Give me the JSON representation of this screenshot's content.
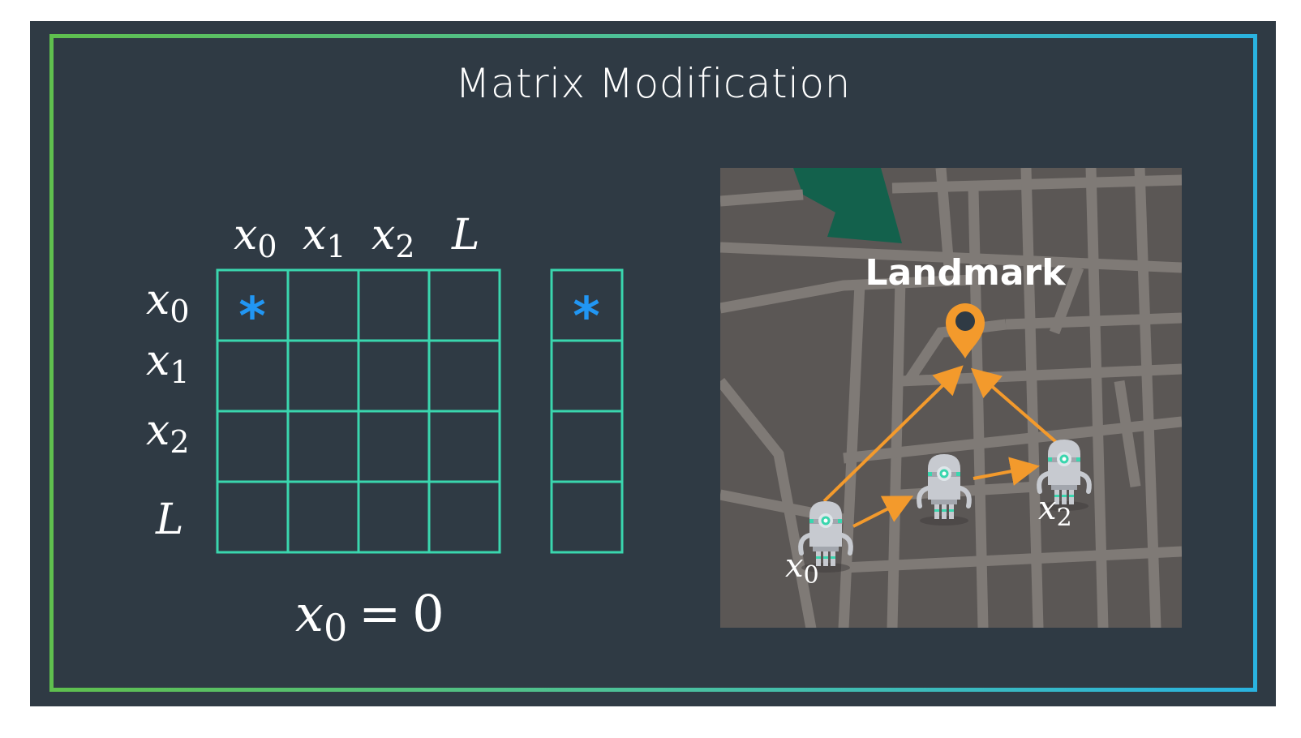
{
  "slide": {
    "title": "Matrix Modification",
    "colors": {
      "background": "#2f3a44",
      "frame_left": "#5fbf4e",
      "frame_right": "#2ab3e0",
      "grid": "#3ad6ae",
      "star": "#2196f3",
      "map": "#5b5755",
      "road": "#7f7a76",
      "park": "#13614c",
      "arrow": "#f39a2c",
      "pin": "#f39a2c"
    }
  },
  "matrix": {
    "col_headers": [
      {
        "var": "x",
        "sub": "0"
      },
      {
        "var": "x",
        "sub": "1"
      },
      {
        "var": "x",
        "sub": "2"
      },
      {
        "var": "L",
        "sub": ""
      }
    ],
    "row_headers": [
      {
        "var": "x",
        "sub": "0"
      },
      {
        "var": "x",
        "sub": "1"
      },
      {
        "var": "x",
        "sub": "2"
      },
      {
        "var": "L",
        "sub": ""
      }
    ],
    "star_cell": {
      "row": 0,
      "col": 0,
      "symbol": "*"
    },
    "vector_star": {
      "row": 0,
      "symbol": "*"
    }
  },
  "equation": {
    "lhs_var": "x",
    "lhs_sub": "0",
    "op": "=",
    "rhs": "0"
  },
  "map": {
    "landmark_label": "Landmark",
    "pin_icon": "map-pin-icon",
    "robot_icon": "robot-icon",
    "robots": [
      {
        "var": "x",
        "sub": "0"
      },
      {
        "var": "",
        "sub": ""
      },
      {
        "var": "x",
        "sub": "2"
      }
    ]
  }
}
